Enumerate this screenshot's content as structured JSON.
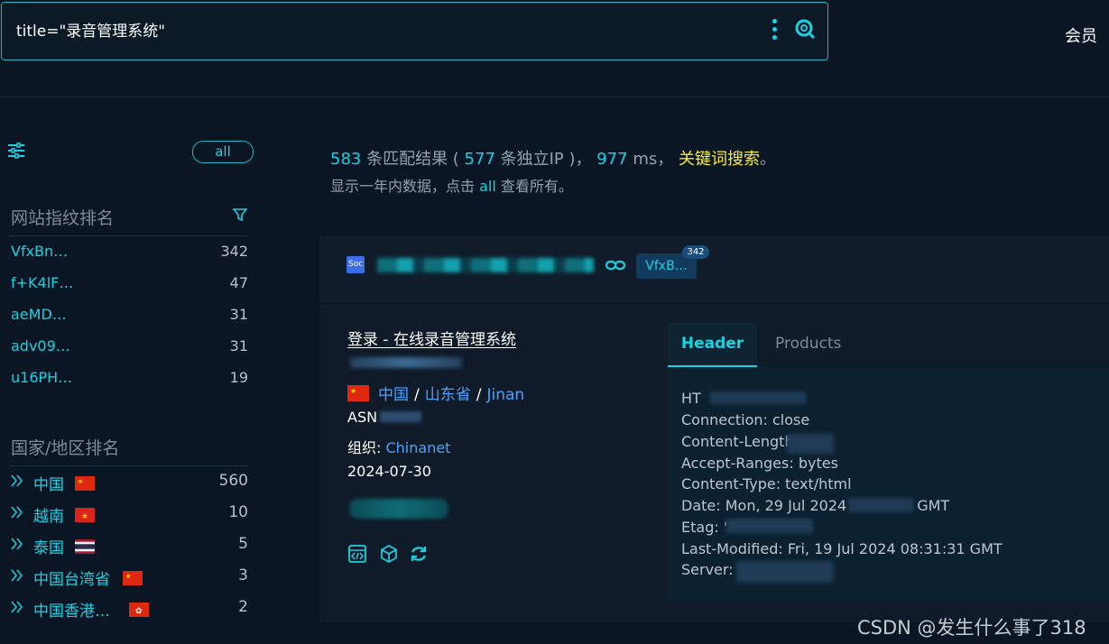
{
  "search": {
    "query": "title=\"录音管理系统\""
  },
  "nav": {
    "member_label": "会员"
  },
  "sidebar": {
    "all_label": "all",
    "fingerprint_title": "网站指纹排名",
    "fingerprints": [
      {
        "label": "VfxBn…",
        "count": "342"
      },
      {
        "label": "f+K4lF…",
        "count": "47"
      },
      {
        "label": "aeMD…",
        "count": "31"
      },
      {
        "label": "adv09…",
        "count": "31"
      },
      {
        "label": "u16PH…",
        "count": "19"
      }
    ],
    "country_title": "国家/地区排名",
    "countries": [
      {
        "label": "中国",
        "count": "560",
        "flag": "cn-flag"
      },
      {
        "label": "越南",
        "count": "10",
        "flag": "vn-flag"
      },
      {
        "label": "泰国",
        "count": "5",
        "flag": "th-flag"
      },
      {
        "label": "中国台湾省",
        "count": "3",
        "flag": "cn-flag"
      },
      {
        "label": "中国香港…",
        "count": "2",
        "flag": "hk-flag"
      }
    ]
  },
  "summary": {
    "results": "583",
    "results_text": " 条匹配结果 ( ",
    "ips": "577",
    "ips_text": " 条独立IP )， ",
    "ms": "977",
    "ms_text": " ms， ",
    "keyword": "关键词搜索",
    "end": "。",
    "line2_prefix": "显示一年内数据，点击 ",
    "line2_all": "all",
    "line2_suffix": " 查看所有。"
  },
  "result": {
    "site_icon_text": "Soc",
    "tag": "VfxB…",
    "tag_count": "342",
    "title": "登录 - 在线录音管理系统",
    "country": "中国",
    "province": "山东省",
    "city": "Jinan",
    "sep": "/",
    "asn_label": "ASN",
    "org_label": "组织: ",
    "org": "Chinanet",
    "date": "2024-07-30"
  },
  "tabs": {
    "header": "Header",
    "products": "Products"
  },
  "headers": {
    "l1": "HT",
    "l2": "Connection: close",
    "l3": "Content-Length",
    "l4": "Accept-Ranges: bytes",
    "l5": "Content-Type: text/html",
    "l6a": "Date: Mon, 29 Jul 2024",
    "l6b": "GMT",
    "l7": "Etag: '",
    "l8": "Last-Modified: Fri, 19 Jul 2024 08:31:31 GMT",
    "l9": "Server: "
  },
  "watermark": "CSDN @发生什么事了318",
  "colors": {
    "accent": "#19d3e2",
    "link": "#4aa3ff",
    "keyword": "#f5ea3a",
    "bg": "#0b1624"
  }
}
